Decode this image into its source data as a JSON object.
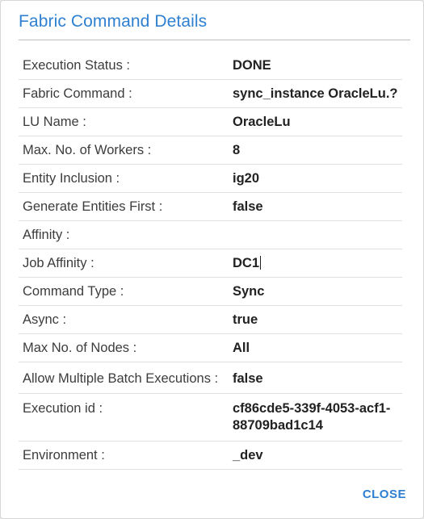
{
  "dialog": {
    "title": "Fabric Command Details",
    "close_label": "CLOSE",
    "rows": [
      {
        "label": "Execution Status :",
        "value": "DONE"
      },
      {
        "label": "Fabric Command :",
        "value": "sync_instance OracleLu.?"
      },
      {
        "label": "LU Name :",
        "value": "OracleLu"
      },
      {
        "label": "Max. No. of Workers :",
        "value": "8"
      },
      {
        "label": "Entity Inclusion :",
        "value": "ig20"
      },
      {
        "label": "Generate Entities First :",
        "value": "false"
      },
      {
        "label": "Affinity :",
        "value": ""
      },
      {
        "label": "Job Affinity :",
        "value": "DC1"
      },
      {
        "label": "Command Type :",
        "value": "Sync"
      },
      {
        "label": "Async :",
        "value": "true"
      },
      {
        "label": "Max No. of Nodes :",
        "value": "All"
      },
      {
        "label": "Allow Multiple Batch Executions :",
        "value": "false"
      },
      {
        "label": "Execution id :",
        "value": "cf86cde5-339f-4053-acf1-88709bad1c14"
      },
      {
        "label": "Environment :",
        "value": "_dev"
      }
    ]
  }
}
